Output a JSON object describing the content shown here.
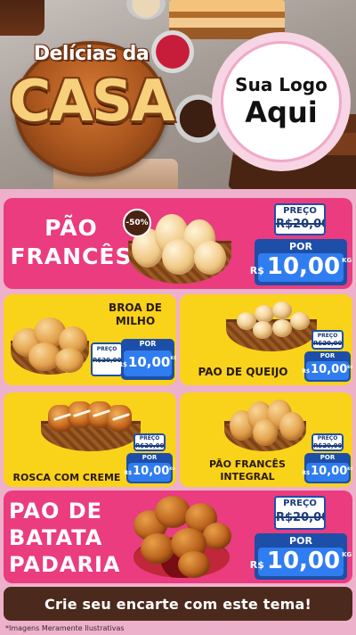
{
  "header": {
    "logo_small": "Delícias da",
    "logo_big": "CASA",
    "brand_line1": "Sua Logo",
    "brand_line2": "Aqui"
  },
  "products": [
    {
      "name_lines": [
        "PÃO",
        "FRANCÊS"
      ],
      "discount": "-50%",
      "price_old_label": "PREÇO",
      "price_old": "R$20,00",
      "price_new_label": "POR",
      "currency": "R$",
      "price_new": "10,00",
      "unit": "KG"
    },
    {
      "name_lines": [
        "BROA DE",
        "MILHO"
      ],
      "price_old_label": "PREÇO",
      "price_old": "R$20,00",
      "price_new_label": "POR",
      "currency": "R$",
      "price_new": "10,00",
      "unit": "KG"
    },
    {
      "name_lines": [
        "PAO DE QUEIJO"
      ],
      "price_old_label": "PREÇO",
      "price_old": "R$20,00",
      "price_new_label": "POR",
      "currency": "R$",
      "price_new": "10,00",
      "unit": "KG"
    },
    {
      "name_lines": [
        "ROSCA COM CREME"
      ],
      "price_old_label": "PREÇO",
      "price_old": "R$20,00",
      "price_new_label": "POR",
      "currency": "R$",
      "price_new": "10,00",
      "unit": "KG"
    },
    {
      "name_lines": [
        "PÃO FRANCÊS",
        "INTEGRAL"
      ],
      "price_old_label": "PREÇO",
      "price_old": "R$20,00",
      "price_new_label": "POR",
      "currency": "R$",
      "price_new": "10,00",
      "unit": "KG"
    },
    {
      "name_lines": [
        "PAO DE",
        "BATATA",
        "PADARIA"
      ],
      "price_old_label": "PREÇO",
      "price_old": "R$20,00",
      "price_new_label": "POR",
      "currency": "R$",
      "price_new": "10,00",
      "unit": "KG"
    }
  ],
  "footer": {
    "banner": "Crie seu encarte com este tema!",
    "disclaimer": "*Imagens Meramente Ilustrativas"
  },
  "colors": {
    "pink_card": "#ea3c7f",
    "yellow_card": "#f9d21a",
    "price_blue": "#1d4fa8",
    "banner_brown": "#4b2a1d"
  }
}
